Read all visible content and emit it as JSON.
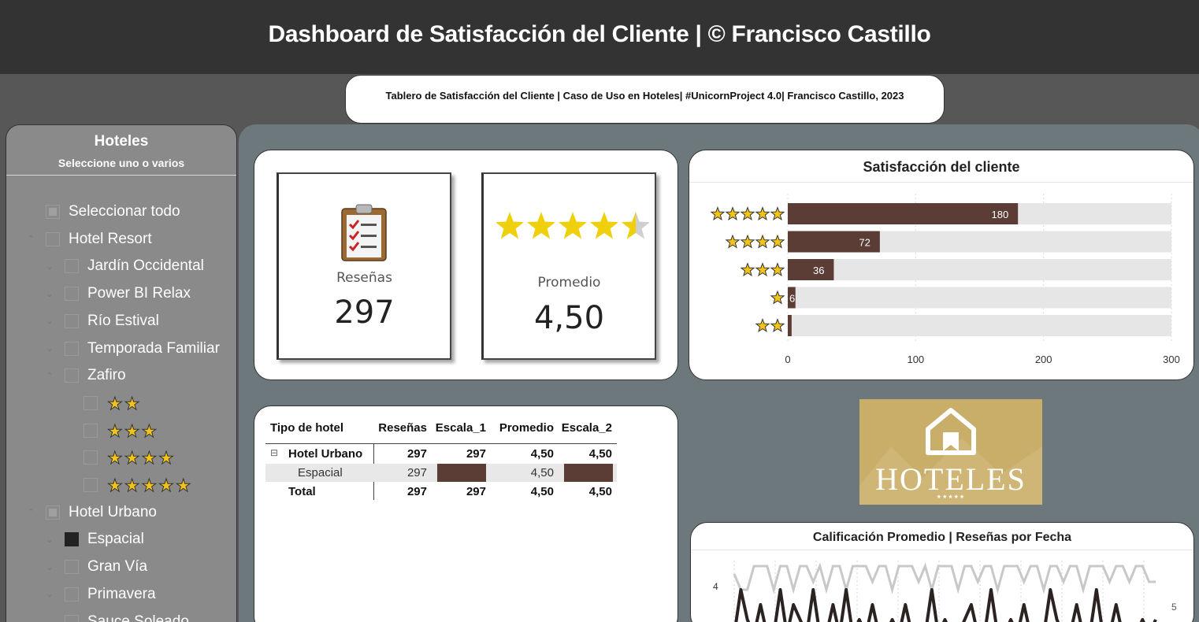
{
  "header": {
    "title": "Dashboard de Satisfacción del Cliente | © Francisco Castillo",
    "subtitle": "Tablero de Satisfacción del Cliente | Caso de Uso en Hoteles| #UnicornProject 4.0| Francisco Castillo, 2023"
  },
  "slicer": {
    "title": "Hoteles",
    "subtitle": "Seleccione uno o varios",
    "select_all": "Seleccionar todo",
    "items": [
      {
        "label": "Hotel Resort",
        "level": 0,
        "state": "empty",
        "chevron": "up"
      },
      {
        "label": "Jardín Occidental",
        "level": 1,
        "state": "empty",
        "chevron": "down"
      },
      {
        "label": "Power BI Relax",
        "level": 1,
        "state": "empty",
        "chevron": "down"
      },
      {
        "label": "Río Estival",
        "level": 1,
        "state": "empty",
        "chevron": "down"
      },
      {
        "label": "Temporada Familiar",
        "level": 1,
        "state": "empty",
        "chevron": "down"
      },
      {
        "label": "Zafiro",
        "level": 1,
        "state": "empty",
        "chevron": "up"
      },
      {
        "stars": 2,
        "level": 2,
        "state": "empty"
      },
      {
        "stars": 3,
        "level": 2,
        "state": "empty"
      },
      {
        "stars": 4,
        "level": 2,
        "state": "empty"
      },
      {
        "stars": 5,
        "level": 2,
        "state": "empty"
      },
      {
        "label": "Hotel Urbano",
        "level": 0,
        "state": "partial",
        "chevron": "up"
      },
      {
        "label": "Espacial",
        "level": 1,
        "state": "full",
        "chevron": "down"
      },
      {
        "label": "Gran Vía",
        "level": 1,
        "state": "empty",
        "chevron": "down"
      },
      {
        "label": "Primavera",
        "level": 1,
        "state": "empty",
        "chevron": "down"
      },
      {
        "label": "Sauce Soleado",
        "level": 1,
        "state": "empty",
        "chevron": "down"
      }
    ]
  },
  "kpis": {
    "reviews_label": "Reseñas",
    "reviews_value": "297",
    "avg_label": "Promedio",
    "avg_value": "4,50",
    "avg_stars_rating": 4.5
  },
  "colors": {
    "bar": "#5c3d36",
    "bar_track": "#e6e6e6",
    "star": "#f2c41a",
    "line_dark": "#2b2222",
    "line_light": "#c8c8c8",
    "logo_bg": "#c9ae6a"
  },
  "chart_data": [
    {
      "type": "bar",
      "orientation": "horizontal",
      "title": "Satisfacción del cliente",
      "categories": [
        "★★★★★",
        "★★★★",
        "★★★",
        "★",
        "★★"
      ],
      "category_stars": [
        5,
        4,
        3,
        1,
        2
      ],
      "values": [
        180,
        72,
        36,
        6,
        3
      ],
      "data_labels": [
        "180",
        "72",
        "36",
        "6",
        ""
      ],
      "xlim": [
        0,
        300
      ],
      "x_ticks": [
        "0",
        "100",
        "200",
        "300"
      ],
      "grid": true
    },
    {
      "type": "line",
      "title": "Calificación Promedio | Reseñas por Fecha",
      "left_axis_ticks": [
        "4"
      ],
      "right_axis_ticks": [
        "5"
      ],
      "series": [
        {
          "values": [
            4.6,
            4.2,
            4.2,
            4.8,
            4.8,
            4.8,
            4.2,
            4.8,
            4.8,
            4.2,
            4.8,
            4.8,
            4.4,
            4.8,
            4.2,
            4.8,
            4.8,
            4.2,
            4.8,
            4.8,
            4.8,
            4.4,
            4.8,
            4.8,
            4.2,
            4.8,
            4.8,
            4.8,
            4.4,
            4.8,
            4.2,
            4.8,
            4.8,
            4.8,
            4.2,
            4.8,
            4.8,
            4.4,
            4.8,
            4.8,
            4.2,
            4.8,
            4.8,
            4.8,
            4.4,
            4.8,
            4.8,
            4.2,
            4.8,
            4.8,
            4.4,
            4.8,
            4.8,
            4.2,
            4.8,
            4.8,
            4.8,
            4.4,
            4.8,
            4.8,
            4.4,
            4.8,
            4.8,
            4.4,
            4.4
          ]
        },
        {
          "values": [
            0,
            3,
            1,
            0,
            2,
            0,
            0,
            3,
            0,
            2,
            1,
            0,
            3,
            0,
            0,
            2,
            0,
            3,
            0,
            1,
            0,
            2,
            0,
            0,
            1,
            0,
            2,
            0,
            0,
            0,
            3,
            0,
            1,
            0,
            0,
            1,
            2,
            0,
            0,
            3,
            0,
            0,
            1,
            0,
            2,
            0,
            0,
            0,
            3,
            1,
            0,
            0,
            2,
            0,
            0,
            3,
            0,
            0,
            2,
            0,
            0,
            0,
            1,
            0,
            1
          ]
        }
      ]
    }
  ],
  "matrix": {
    "headers": [
      "Tipo de hotel",
      "Reseñas",
      "Escala_1",
      "Promedio",
      "Escala_2"
    ],
    "parent_row": {
      "toggle": "⊟",
      "label": "Hotel Urbano",
      "values": [
        "297",
        "297",
        "4,50",
        "4,50"
      ]
    },
    "child_row": {
      "label": "Espacial",
      "resenas": "297",
      "promedio": "4,50"
    },
    "total_row": {
      "label": "Total",
      "values": [
        "297",
        "297",
        "4,50",
        "4,50"
      ]
    }
  },
  "logo": {
    "text": "HOTELES",
    "stars": "★★★★★"
  }
}
